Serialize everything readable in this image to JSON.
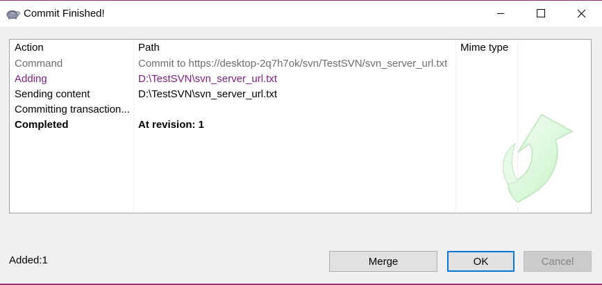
{
  "window": {
    "title": "Commit Finished!",
    "accent_color": "#9c2f7a",
    "icon": "tortoise-icon",
    "controls": [
      "minimize-icon",
      "maximize-icon",
      "close-icon"
    ]
  },
  "log": {
    "columns": [
      "Action",
      "Path",
      "Mime type"
    ],
    "rows": [
      {
        "action": "Command",
        "path": "Commit to https://desktop-2q7h7ok/svn/TestSVN/svn_server_url.txt",
        "mime": "",
        "style": "gray"
      },
      {
        "action": "Adding",
        "path": "D:\\TestSVN\\svn_server_url.txt",
        "mime": "",
        "style": "purple"
      },
      {
        "action": "Sending content",
        "path": "D:\\TestSVN\\svn_server_url.txt",
        "mime": "",
        "style": "normal"
      },
      {
        "action": "Committing transaction...",
        "path": "",
        "mime": "",
        "style": "normal"
      },
      {
        "action": "Completed",
        "path": "At revision: 1",
        "mime": "",
        "style": "bold"
      }
    ],
    "watermark_icon": "green-curved-arrow-icon"
  },
  "footer": {
    "status": "Added:1",
    "merge_label": "Merge",
    "ok_label": "OK",
    "cancel_label": "Cancel"
  }
}
